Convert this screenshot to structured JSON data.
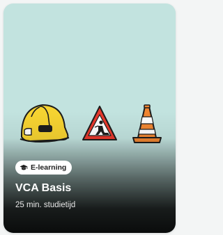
{
  "card": {
    "badge_label": "E-learning",
    "title": "VCA Basis",
    "subtitle": "25 min. studietijd"
  },
  "icons": {
    "badge": "graduation-cap-icon",
    "illustrations": [
      "hard-hat-icon",
      "road-work-sign-icon",
      "traffic-cone-icon"
    ]
  },
  "colors": {
    "card_background": "#c2e3df",
    "badge_background": "#ffffff",
    "title_text": "#ffffff"
  }
}
